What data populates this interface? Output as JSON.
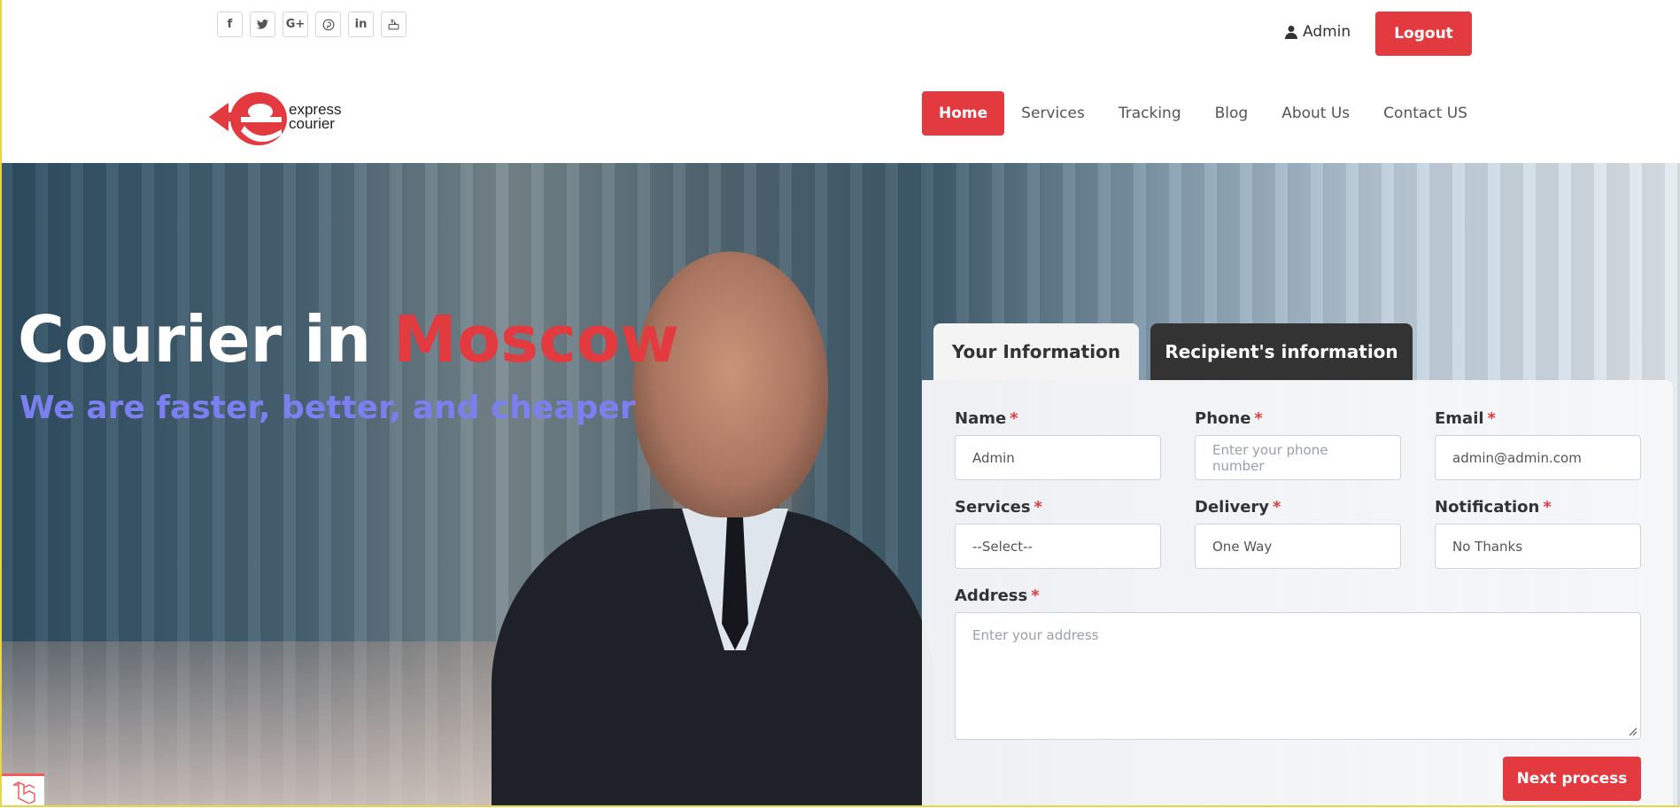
{
  "topbar": {
    "social": [
      {
        "icon": "facebook-icon",
        "glyph": "f"
      },
      {
        "icon": "twitter-icon",
        "glyph": "🐦"
      },
      {
        "icon": "google-plus-icon",
        "glyph": "G+"
      },
      {
        "icon": "pinterest-icon",
        "glyph": "p"
      },
      {
        "icon": "linkedin-icon",
        "glyph": "in"
      },
      {
        "icon": "youtube-icon",
        "glyph": "▶"
      }
    ],
    "user_label": "Admin",
    "logout_label": "Logout"
  },
  "header": {
    "logo_line1": "express",
    "logo_line2": "courier",
    "nav": [
      {
        "label": "Home",
        "active": true
      },
      {
        "label": "Services",
        "active": false
      },
      {
        "label": "Tracking",
        "active": false
      },
      {
        "label": "Blog",
        "active": false
      },
      {
        "label": "About Us",
        "active": false
      },
      {
        "label": "Contact US",
        "active": false
      }
    ]
  },
  "hero": {
    "title_main": "Courier in",
    "title_accent": "Moscow",
    "subtitle": "We are faster, better, and cheaper"
  },
  "tabs": {
    "your_info": "Your Information",
    "recipient_info": "Recipient's information"
  },
  "form": {
    "name": {
      "label": "Name",
      "value": "Admin"
    },
    "phone": {
      "label": "Phone",
      "placeholder": "Enter your phone number"
    },
    "email": {
      "label": "Email",
      "value": "admin@admin.com"
    },
    "services": {
      "label": "Services",
      "value": "--Select--"
    },
    "delivery": {
      "label": "Delivery",
      "value": "One Way"
    },
    "notification": {
      "label": "Notification",
      "value": "No Thanks"
    },
    "address": {
      "label": "Address",
      "placeholder": "Enter your address"
    },
    "required_mark": "*",
    "next_label": "Next process"
  },
  "colors": {
    "accent": "#e23a3f",
    "subtitle": "#7b7ff0",
    "dark_tab": "#333333"
  }
}
